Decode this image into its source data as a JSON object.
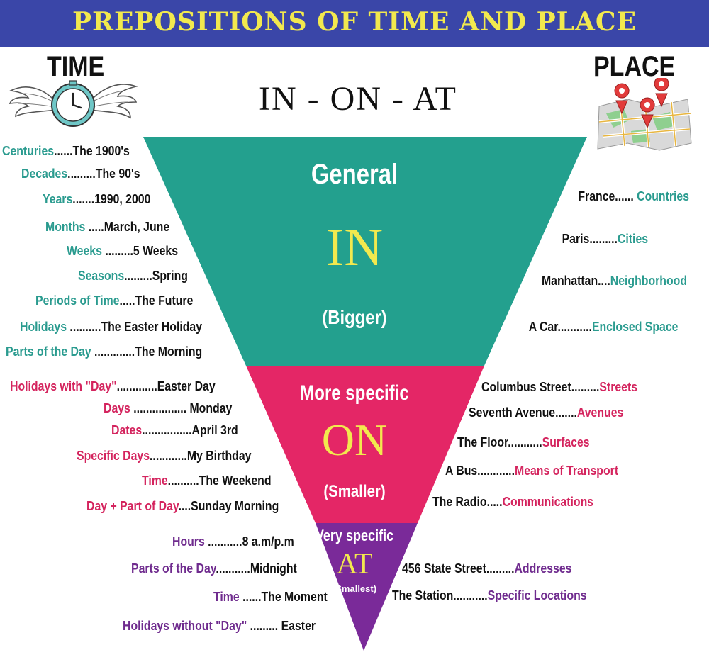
{
  "title": "PREPOSITIONS OF TIME AND PLACE",
  "header": {
    "time_label": "TIME",
    "place_label": "PLACE",
    "subtitle": "IN - ON - AT"
  },
  "icons": {
    "time": "winged-clock-icon",
    "place": "map-pins-icon"
  },
  "colors": {
    "banner": "#3a46a8",
    "title": "#f2e94e",
    "in": "#23a08e",
    "on": "#e42666",
    "at": "#7a2a99",
    "keyword": "#f2e94e"
  },
  "in": {
    "top": "General",
    "word": "IN",
    "bottom": "(Bigger)"
  },
  "on": {
    "top": "More specific",
    "word": "ON",
    "bottom": "(Smaller)"
  },
  "at": {
    "top": "Very specific",
    "word": "AT",
    "bottom": "(Smallest)"
  },
  "time_in": [
    {
      "cat": "Centuries",
      "ex": "......The 1900's"
    },
    {
      "cat": "Decades",
      "ex": ".........The 90's"
    },
    {
      "cat": "Years",
      "ex": ".......1990, 2000"
    },
    {
      "cat": "Months",
      "ex": " .....March, June"
    },
    {
      "cat": "Weeks",
      "ex": " .........5 Weeks"
    },
    {
      "cat": "Seasons",
      "ex": ".........Spring"
    },
    {
      "cat": "Periods of Time",
      "ex": ".....The Future"
    },
    {
      "cat": "Holidays",
      "ex": " ..........The Easter Holiday"
    },
    {
      "cat": "Parts of the Day",
      "ex": " .............The Morning"
    }
  ],
  "time_on": [
    {
      "cat": "Holidays with \"Day\"",
      "ex": ".............Easter Day"
    },
    {
      "cat": "Days",
      "ex": " ................. Monday"
    },
    {
      "cat": "Dates",
      "ex": "................April 3rd"
    },
    {
      "cat": "Specific Days",
      "ex": "............My Birthday"
    },
    {
      "cat": "Time",
      "ex": "..........The Weekend"
    },
    {
      "cat": "Day + Part of Day",
      "ex": "....Sunday Morning"
    }
  ],
  "time_at": [
    {
      "cat": "Hours",
      "ex": " ...........8 a.m/p.m"
    },
    {
      "cat": "Parts of the Day",
      "ex": "...........Midnight"
    },
    {
      "cat": "Time",
      "ex": " ......The Moment"
    },
    {
      "cat": "Holidays without \"Day\"",
      "ex": " ......... Easter"
    }
  ],
  "place_in": [
    {
      "ex": "France......",
      "cat": " Countries"
    },
    {
      "ex": "Paris.........",
      "cat": "Cities"
    },
    {
      "ex": "Manhattan....",
      "cat": "Neighborhood"
    },
    {
      "ex": "A Car...........",
      "cat": "Enclosed Space"
    }
  ],
  "place_on": [
    {
      "ex": "Columbus Street.........",
      "cat": "Streets"
    },
    {
      "ex": "Seventh Avenue.......",
      "cat": "Avenues"
    },
    {
      "ex": "The Floor...........",
      "cat": "Surfaces"
    },
    {
      "ex": "A Bus............",
      "cat": "Means of Transport"
    },
    {
      "ex": "The Radio.....",
      "cat": "Communications"
    }
  ],
  "place_at": [
    {
      "ex": "456 State Street.........",
      "cat": "Addresses"
    },
    {
      "ex": "The Station...........",
      "cat": "Specific Locations"
    }
  ]
}
